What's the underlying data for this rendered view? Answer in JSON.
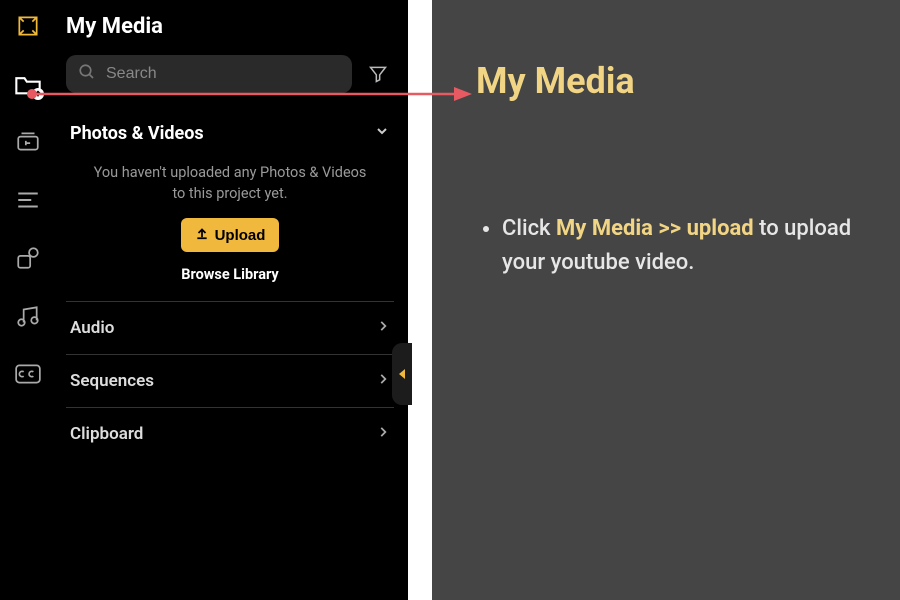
{
  "panel": {
    "title": "My Media",
    "search": {
      "placeholder": "Search"
    },
    "photos_videos": {
      "label": "Photos & Videos",
      "empty_msg": "You haven't uploaded any Photos & Videos to this project yet.",
      "upload_label": "Upload",
      "browse_label": "Browse Library"
    },
    "sections": {
      "audio": "Audio",
      "sequences": "Sequences",
      "clipboard": "Clipboard"
    }
  },
  "instructions": {
    "title": "My Media",
    "bullet_prefix": "Click ",
    "bullet_highlight": "My Media >> upload",
    "bullet_suffix": " to upload your youtube video."
  }
}
